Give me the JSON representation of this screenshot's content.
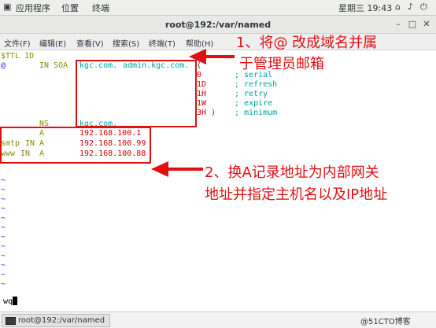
{
  "topbar": {
    "apps": "应用程序",
    "places": "位置",
    "terminal": "终端",
    "datetime": "星期三 19:43"
  },
  "window": {
    "title": "root@192:/var/named"
  },
  "menu": [
    "文件(F)",
    "编辑(E)",
    "查看(V)",
    "搜索(S)",
    "终端(T)",
    "帮助(H)"
  ],
  "zone": {
    "ttl": "$TTL 1D",
    "soa_at": "@",
    "soa_class": "IN SOA",
    "soa_ns": "kgc.com.",
    "soa_admin": "admin.kgc.com.",
    "soa_paren": "(",
    "serial_val": "0",
    "serial_comment": "; serial",
    "refresh_val": "1D",
    "refresh_comment": "; refresh",
    "retry_val": "1H",
    "retry_comment": "; retry",
    "expire_val": "1W",
    "expire_comment": "; expire",
    "minimum_val": "3H )",
    "minimum_comment": "; minimum",
    "ns_type": "NS",
    "ns_value": "kgc.com.",
    "a1_type": "A",
    "a1_value": "192.168.100.1",
    "a2_name": "smtp",
    "a2_class": "IN",
    "a2_type": "A",
    "a2_value": "192.168.100.99",
    "a3_name": "www",
    "a3_class": "IN",
    "a3_type": "A",
    "a3_value": "192.168.100.88",
    "tilde": "~"
  },
  "command": "wq",
  "annotations": {
    "note1_line1": "1、将@ 改成域名并属",
    "note1_line2": "于管理员邮箱",
    "note2_line1": "2、换A记录地址为内部网关",
    "note2_line2": "地址并指定主机名以及IP地址"
  },
  "taskbar": {
    "item": "root@192:/var/named",
    "watermark": "@51CTO博客"
  },
  "colors": {
    "annotation": "#e01010",
    "teal": "#00a0a0",
    "red": "#cc0000"
  }
}
